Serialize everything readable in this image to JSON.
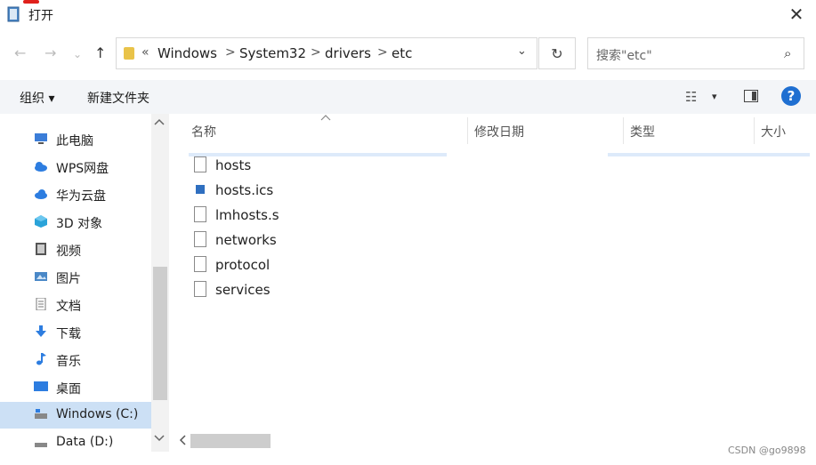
{
  "window": {
    "title": "打开",
    "close": "✕"
  },
  "nav": {
    "back": "←",
    "forward": "→",
    "recent": "⌄",
    "up": "↑",
    "address": {
      "overflow": "«",
      "crumbs": [
        "Windows",
        "System32",
        "drivers",
        "etc"
      ],
      "sep": ">",
      "dropdown": "⌄"
    },
    "refresh": "↻",
    "search": {
      "placeholder": "搜索\"etc\"",
      "icon": "⌕"
    }
  },
  "toolbar": {
    "organize": "组织 ▾",
    "new_folder": "新建文件夹",
    "view_icon": "☷",
    "view_dropdown": "▾",
    "help": "?"
  },
  "sidebar": {
    "items": [
      {
        "label": "此电脑",
        "icon": "pc-icon",
        "color": "#3b7dd8"
      },
      {
        "label": "WPS网盘",
        "icon": "cloud-icon",
        "color": "#2d7de0"
      },
      {
        "label": "华为云盘",
        "icon": "cloud-icon",
        "color": "#2d7de0"
      },
      {
        "label": "3D 对象",
        "icon": "cube-icon",
        "color": "#2aa3d9"
      },
      {
        "label": "视频",
        "icon": "video-icon",
        "color": "#555555"
      },
      {
        "label": "图片",
        "icon": "picture-icon",
        "color": "#4a88c7"
      },
      {
        "label": "文档",
        "icon": "document-icon",
        "color": "#777777"
      },
      {
        "label": "下载",
        "icon": "download-icon",
        "color": "#2d7de0"
      },
      {
        "label": "音乐",
        "icon": "music-icon",
        "color": "#2d7de0"
      },
      {
        "label": "桌面",
        "icon": "desktop-icon",
        "color": "#2d7de0"
      },
      {
        "label": "Windows (C:)",
        "icon": "drive-icon",
        "color": "#666666",
        "selected": true
      },
      {
        "label": "Data (D:)",
        "icon": "drive-icon",
        "color": "#666666"
      }
    ]
  },
  "file_list": {
    "columns": [
      "名称",
      "修改日期",
      "类型",
      "大小"
    ],
    "files": [
      {
        "name": "hosts",
        "icon": "file-icon"
      },
      {
        "name": "hosts.ics",
        "icon": "ics-file-icon"
      },
      {
        "name": "lmhosts.s",
        "icon": "file-icon"
      },
      {
        "name": "networks",
        "icon": "file-icon"
      },
      {
        "name": "protocol",
        "icon": "file-icon"
      },
      {
        "name": "services",
        "icon": "file-icon"
      }
    ]
  },
  "watermark": "CSDN @go9898"
}
